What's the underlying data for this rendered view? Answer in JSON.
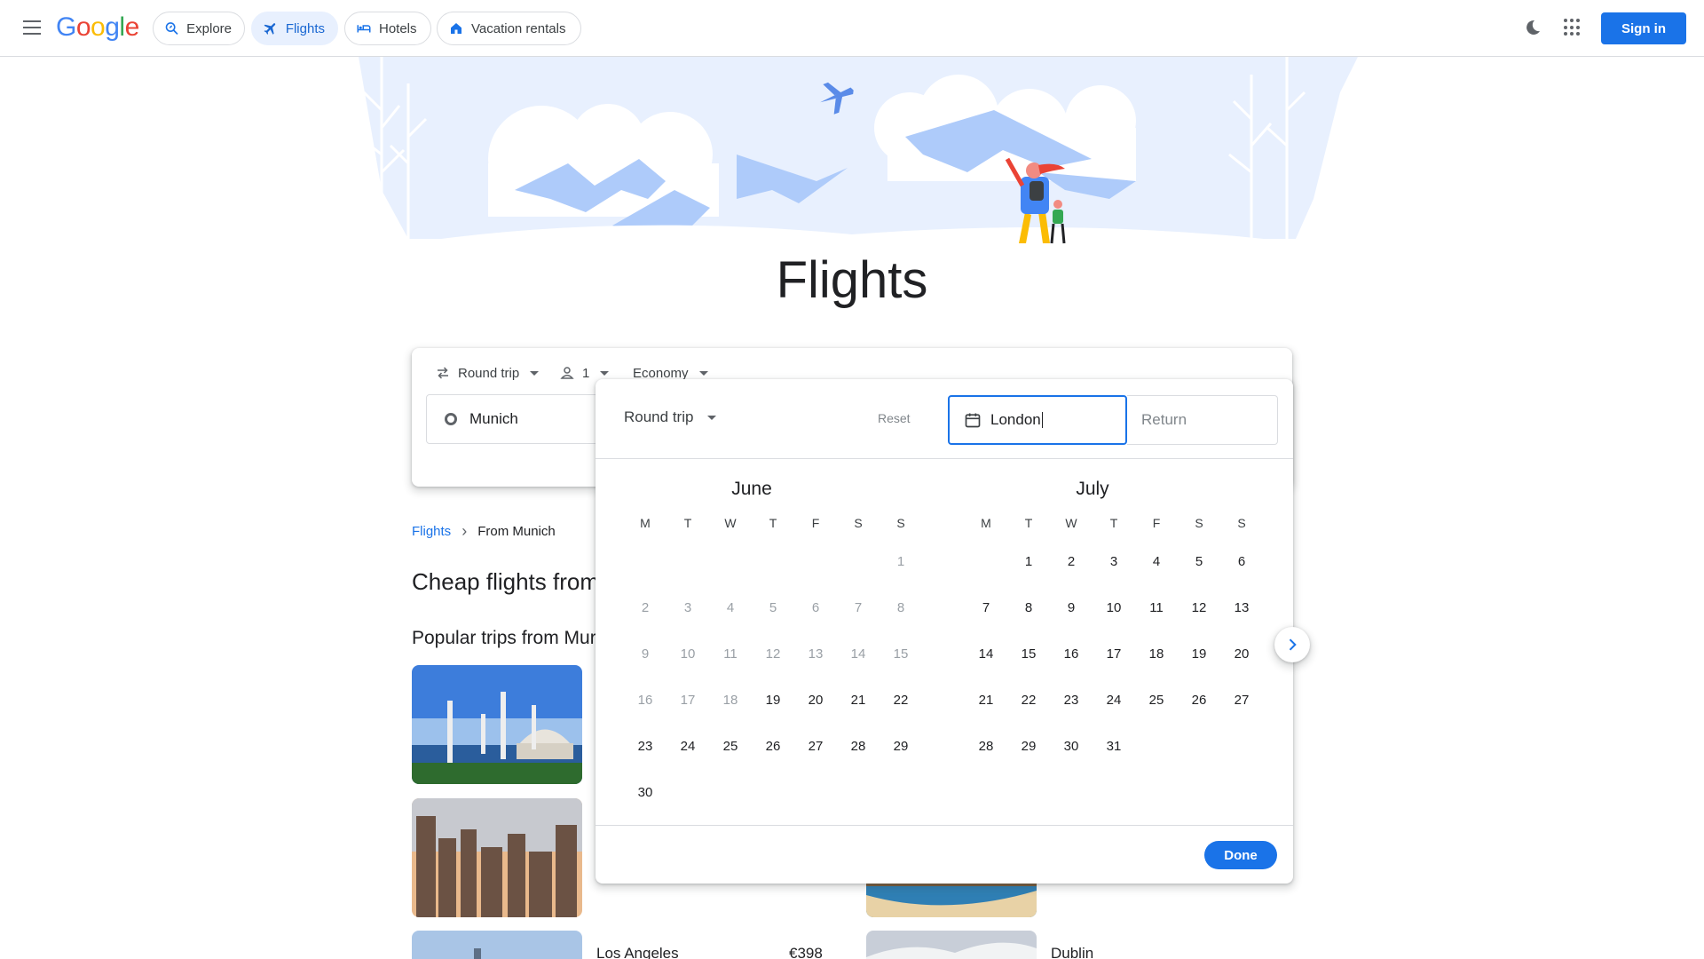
{
  "header": {
    "logo_text": "Google",
    "nav": [
      {
        "label": "Explore",
        "icon": "explore-icon"
      },
      {
        "label": "Flights",
        "icon": "plane-icon",
        "active": true
      },
      {
        "label": "Hotels",
        "icon": "bed-icon"
      },
      {
        "label": "Vacation rentals",
        "icon": "house-icon"
      }
    ],
    "sign_in_label": "Sign in",
    "accent_color": "#1a73e8"
  },
  "hero": {
    "title": "Flights"
  },
  "search": {
    "trip_type": "Round trip",
    "passengers": "1",
    "cabin_class": "Economy",
    "origin": "Munich"
  },
  "picker": {
    "trip_type": "Round trip",
    "reset_label": "Reset",
    "from_value": "London",
    "return_placeholder": "Return",
    "done_label": "Done",
    "weekday_labels": [
      "M",
      "T",
      "W",
      "T",
      "F",
      "S",
      "S"
    ],
    "months": [
      {
        "name": "June",
        "weeks": [
          [
            "",
            "",
            "",
            "",
            "",
            "",
            "1"
          ],
          [
            "2",
            "3",
            "4",
            "5",
            "6",
            "7",
            "8"
          ],
          [
            "9",
            "10",
            "11",
            "12",
            "13",
            "14",
            "15"
          ],
          [
            "16",
            "17",
            "18",
            "19",
            "20",
            "21",
            "22"
          ],
          [
            "23",
            "24",
            "25",
            "26",
            "27",
            "28",
            "29"
          ],
          [
            "30",
            "",
            "",
            "",
            "",
            "",
            ""
          ]
        ],
        "first_available_day": 19
      },
      {
        "name": "July",
        "weeks": [
          [
            "",
            "1",
            "2",
            "3",
            "4",
            "5",
            "6"
          ],
          [
            "7",
            "8",
            "9",
            "10",
            "11",
            "12",
            "13"
          ],
          [
            "14",
            "15",
            "16",
            "17",
            "18",
            "19",
            "20"
          ],
          [
            "21",
            "22",
            "23",
            "24",
            "25",
            "26",
            "27"
          ],
          [
            "28",
            "29",
            "30",
            "31",
            "",
            "",
            ""
          ]
        ],
        "first_available_day": 1
      }
    ]
  },
  "breadcrumb": {
    "root": "Flights",
    "current": "From Munich"
  },
  "content": {
    "cheap_title": "Cheap flights from",
    "popular_title": "Popular trips from Mur",
    "trips": [
      {
        "name": "Los Angeles",
        "price": "€398"
      },
      {
        "name": "Dublin",
        "price": ""
      }
    ]
  }
}
